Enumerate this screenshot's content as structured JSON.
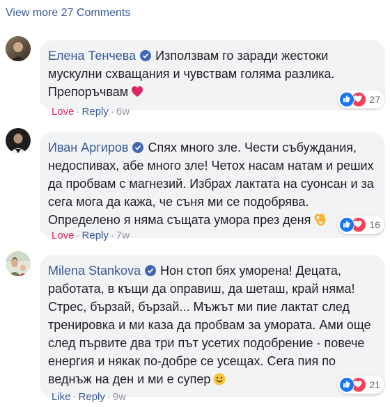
{
  "view_more": "View more 27 Comments",
  "comments": [
    {
      "author": "Елена Тенчева",
      "text": "Използвам го заради жестоки мускулни схващания и чувствам голяма разлика. Препоръчвам",
      "emoji": "heart-emoji",
      "reaction_label": "Love",
      "reply_label": "Reply",
      "time": "6w",
      "reaction_count": "27"
    },
    {
      "author": "Иван Аргиров",
      "text": "Спях много зле. Чести събуждания, недоспивах, абе много зле! Четох насам натам и реших да пробвам с магнезий. Избрах лактата на суонсан и за сега мога да кажа, че съня ми се подобрява. Определено я няма същата умора през деня",
      "emoji": "ok-hand-emoji",
      "reaction_label": "Love",
      "reply_label": "Reply",
      "time": "7w",
      "reaction_count": "16"
    },
    {
      "author": "Milena Stankova",
      "text": "Нон стоп бях уморена! Децата, работата, в къщи да оправиш, да шеташ, край няма! Стрес, бързай, бързай... Мъжът ми пие лактат след тренировка и ми каза да пробвам за умората. Ами още след първите два три път усетих подобрение - повече енергия и някак по-добре се усещах. Сега пия по веднъж на ден и ми е супер",
      "emoji": "smile-emoji",
      "reaction_label": "Like",
      "reply_label": "Reply",
      "time": "9w",
      "reaction_count": "21"
    }
  ],
  "colors": {
    "link": "#385898",
    "love": "#e0245e",
    "bubble": "#f2f3f5",
    "verified": "#4267b2"
  }
}
